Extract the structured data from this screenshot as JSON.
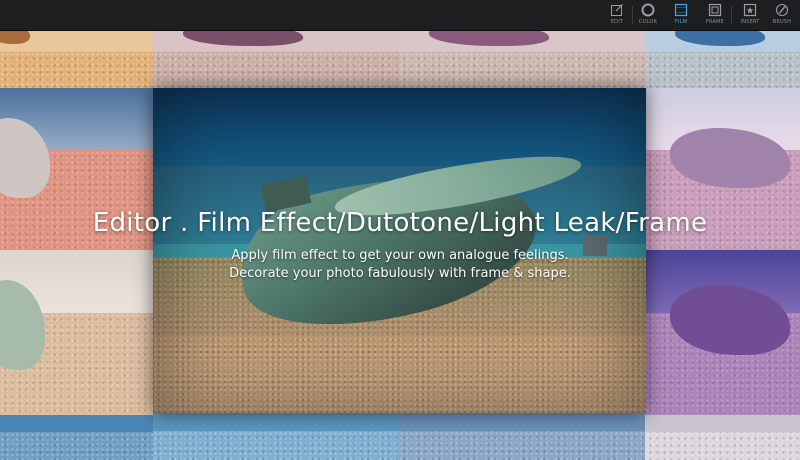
{
  "toolbar": {
    "items": [
      {
        "label": "EDIT",
        "icon": "edit-icon"
      },
      {
        "label": "COLOR",
        "icon": "color-icon"
      },
      {
        "label": "FILM",
        "icon": "film-icon",
        "active": true
      },
      {
        "label": "FRAME",
        "icon": "frame-icon"
      },
      {
        "label": "INSERT",
        "icon": "insert-icon"
      },
      {
        "label": "BRUSH",
        "icon": "brush-icon"
      }
    ],
    "active_color": "#3fa9f5"
  },
  "hero": {
    "title": "Editor . Film Effect/Dutotone/Light Leak/Frame",
    "subtitle_line1": "Apply film effect to get your own analogue feelings.",
    "subtitle_line2": "Decorate your photo fabulously with frame & shape."
  }
}
